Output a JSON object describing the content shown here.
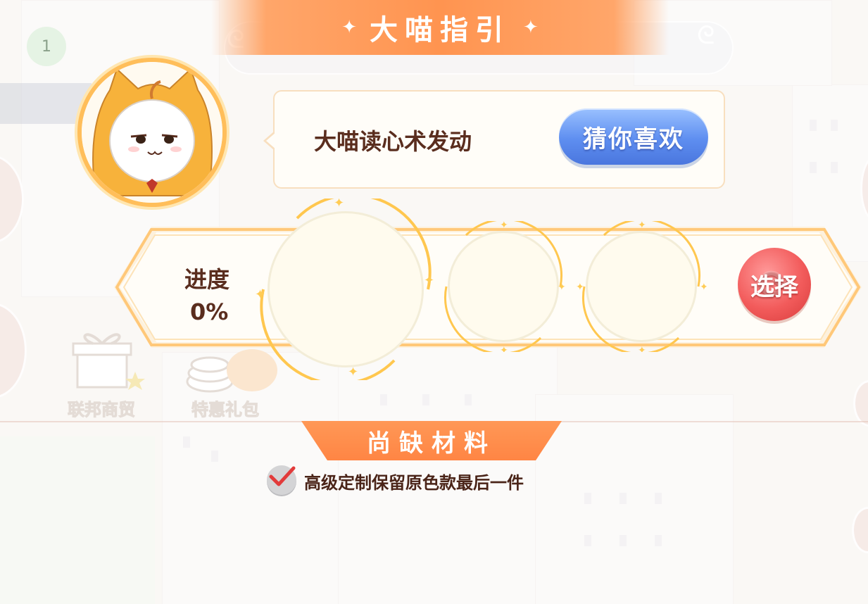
{
  "header": {
    "title": "大喵指引",
    "badge_count": "1"
  },
  "dialog": {
    "message": "大喵读心术发动",
    "guess_button": "猜你喜欢"
  },
  "progress": {
    "label": "进度",
    "value": "0%",
    "value_fraction": 0,
    "select_button": "选择"
  },
  "background_menu": {
    "items": [
      "联邦商贸",
      "特惠礼包"
    ]
  },
  "materials": {
    "title": "尚缺材料",
    "items": [
      {
        "label": "高级定制保留原色款最后一件",
        "checked": true
      }
    ]
  },
  "colors": {
    "title_orange": "#ff9450",
    "guess_blue": "#5e8ef0",
    "select_red": "#f25b5b",
    "text_brown": "#5a2d1e"
  },
  "icons": [
    "cat-mascot-icon",
    "sparkle-icon",
    "check-icon",
    "refresh-icon",
    "gift-icon",
    "coin-icon"
  ]
}
